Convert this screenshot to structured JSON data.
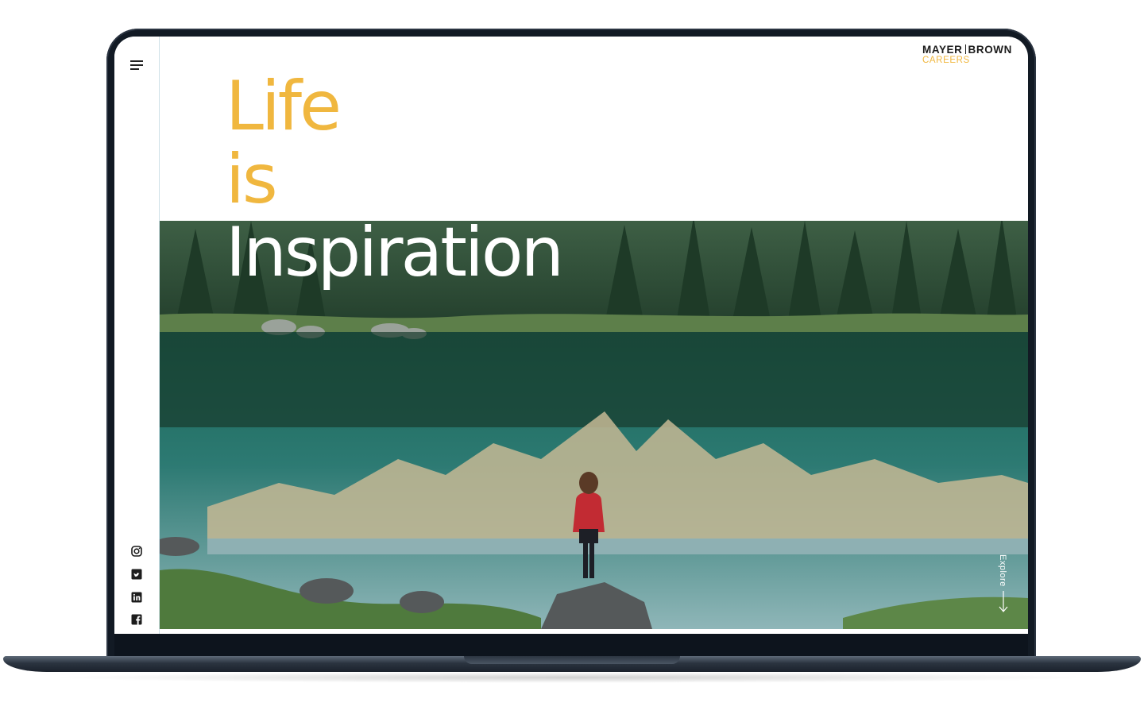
{
  "header": {
    "logo_left": "MAYER",
    "logo_right": "BROWN",
    "logo_sub": "CAREERS"
  },
  "hero": {
    "line1": "Life",
    "line2": "is",
    "line3": "Inspiration",
    "explore_label": "Explore"
  },
  "sidebar": {
    "menu_icon": "hamburger-icon",
    "social": [
      "instagram-icon",
      "twitter-icon",
      "linkedin-icon",
      "facebook-icon"
    ]
  },
  "colors": {
    "accent": "#f0b73f",
    "frame": "#121a24",
    "text_dark": "#1c1c1c"
  }
}
